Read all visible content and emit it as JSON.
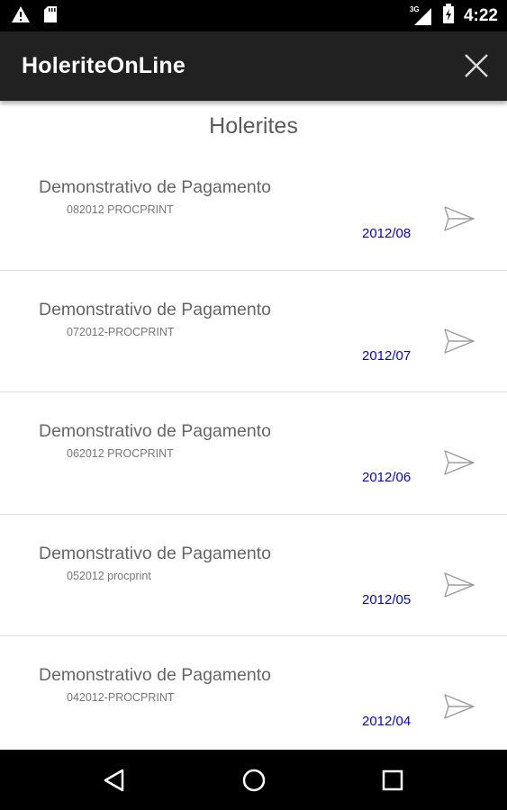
{
  "status_bar": {
    "time": "4:22",
    "network": "3G",
    "icons": [
      "warning-icon",
      "sd-card-icon",
      "signal-icon",
      "battery-charging-icon"
    ]
  },
  "app_bar": {
    "title": "HoleriteOnLine",
    "close_icon": "close-icon"
  },
  "screen": {
    "title": "Holerites"
  },
  "items": [
    {
      "title": "Demonstrativo de Pagamento",
      "code": "082012 PROCPRINT",
      "date": "2012/08"
    },
    {
      "title": "Demonstrativo de Pagamento",
      "code": "072012-PROCPRINT",
      "date": "2012/07"
    },
    {
      "title": "Demonstrativo de Pagamento",
      "code": "062012 PROCPRINT",
      "date": "2012/06"
    },
    {
      "title": "Demonstrativo de Pagamento",
      "code": "052012 procprint",
      "date": "2012/05"
    },
    {
      "title": "Demonstrativo de Pagamento",
      "code": "042012-PROCPRINT",
      "date": "2012/04"
    }
  ],
  "item_icon": "send-icon",
  "nav_bar": {
    "icons": [
      "back-icon",
      "home-icon",
      "recents-icon"
    ]
  },
  "colors": {
    "status_bar": "#000000",
    "app_bar": "#212121",
    "date_link": "#0000ee",
    "divider": "#e0e0e0"
  }
}
